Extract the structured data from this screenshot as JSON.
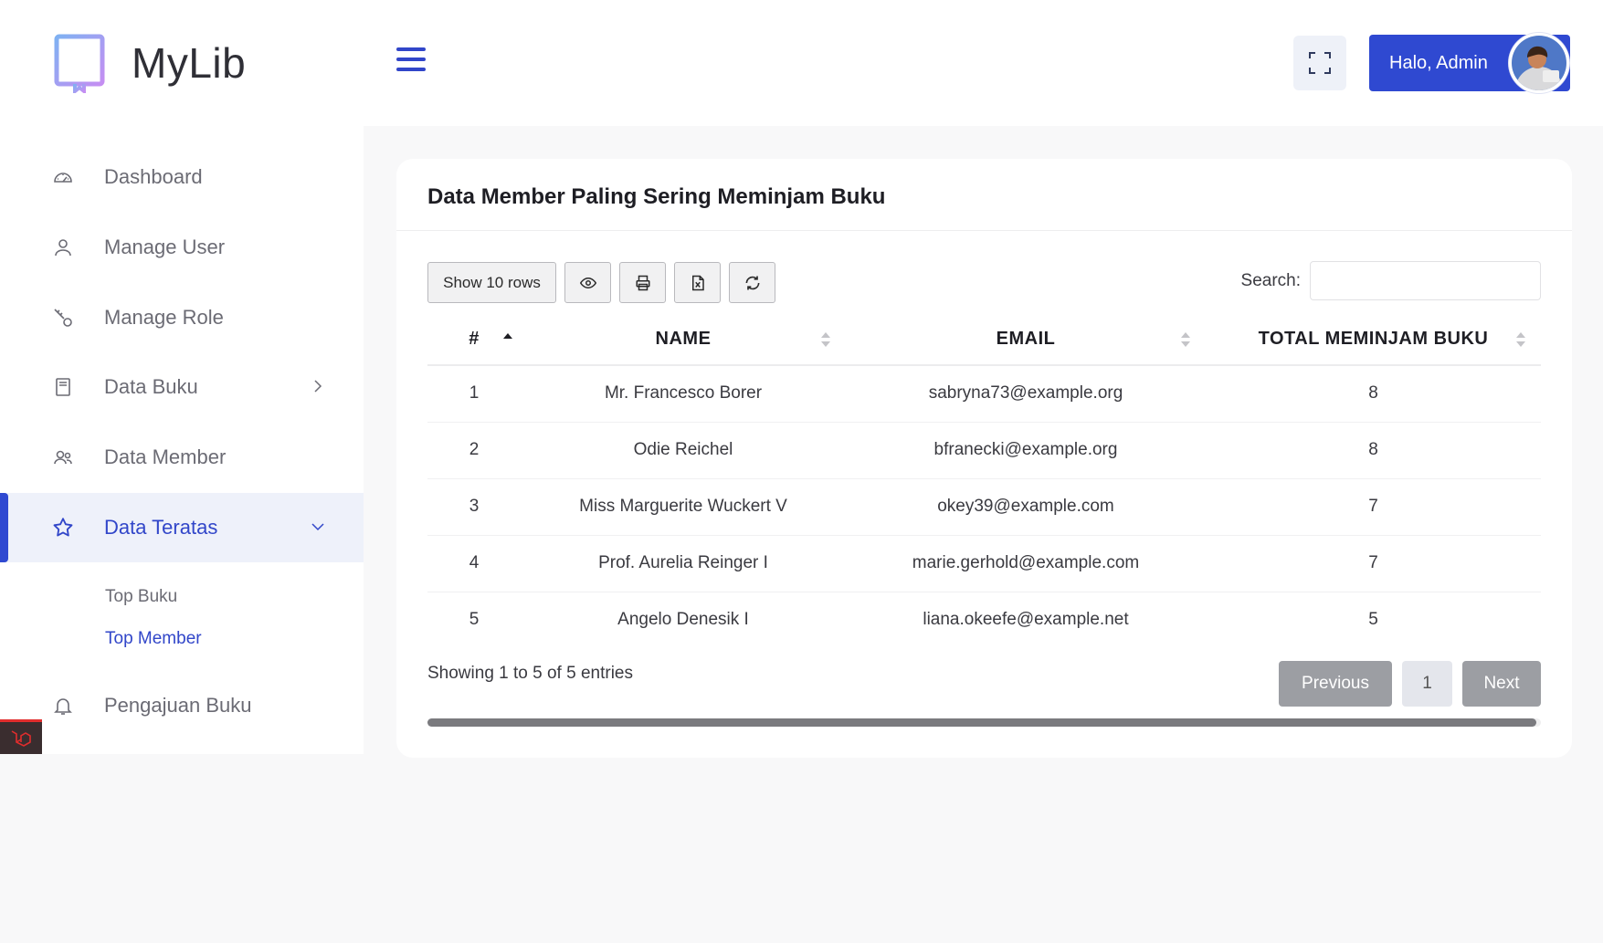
{
  "brand": {
    "name": "MyLib"
  },
  "sidebar": {
    "items": [
      {
        "label": "Dashboard",
        "icon": "dashboard-gauge-icon"
      },
      {
        "label": "Manage User",
        "icon": "user-icon"
      },
      {
        "label": "Manage Role",
        "icon": "key-icon"
      },
      {
        "label": "Data Buku",
        "icon": "book-icon",
        "has_children": true
      },
      {
        "label": "Data Member",
        "icon": "users-icon"
      },
      {
        "label": "Data Teratas",
        "icon": "star-icon",
        "active": true,
        "expanded": true
      },
      {
        "label": "Pengajuan Buku",
        "icon": "bell-icon"
      }
    ],
    "submenu": [
      {
        "label": "Top Buku"
      },
      {
        "label": "Top Member",
        "active": true
      }
    ]
  },
  "topbar": {
    "user_label": "Halo, Admin"
  },
  "card": {
    "title": "Data Member Paling Sering Meminjam Buku",
    "toolbar": {
      "show_rows_label": "Show 10 rows"
    },
    "search_label": "Search:",
    "search_value": "",
    "columns": [
      "#",
      "NAME",
      "EMAIL",
      "TOTAL MEMINJAM BUKU"
    ],
    "rows": [
      {
        "no": "1",
        "name": "Mr. Francesco Borer",
        "email": "sabryna73@example.org",
        "total": "8"
      },
      {
        "no": "2",
        "name": "Odie Reichel",
        "email": "bfranecki@example.org",
        "total": "8"
      },
      {
        "no": "3",
        "name": "Miss Marguerite Wuckert V",
        "email": "okey39@example.com",
        "total": "7"
      },
      {
        "no": "4",
        "name": "Prof. Aurelia Reinger I",
        "email": "marie.gerhold@example.com",
        "total": "7"
      },
      {
        "no": "5",
        "name": "Angelo Denesik I",
        "email": "liana.okeefe@example.net",
        "total": "5"
      }
    ],
    "info": "Showing 1 to 5 of 5 entries",
    "pagination": {
      "previous": "Previous",
      "page": "1",
      "next": "Next"
    }
  },
  "colors": {
    "accent": "#2f49d1",
    "active_bg": "#eef1fa",
    "pager_disabled": "#9c9ea3"
  }
}
